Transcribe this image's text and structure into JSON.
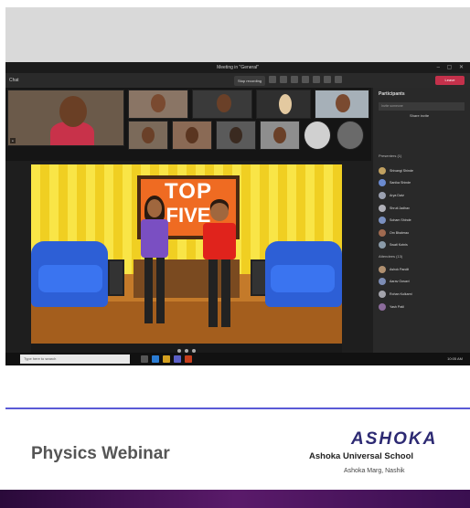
{
  "window": {
    "title": "Meeting in \"General\""
  },
  "toolbar": {
    "left_label": "Chat",
    "record_label": "Stop recording",
    "leave_label": "Leave"
  },
  "participants_panel": {
    "title": "Participants",
    "search_placeholder": "Invite someone",
    "share_label": "Share invite",
    "section_presenters": "Presenters (1)",
    "section_attendees": "Attendees (13)",
    "names": [
      "Shivangi Shinde",
      "Sanika Shinde",
      "Arya Dalvi",
      "Shruti Jadhav",
      "Soham Shinde",
      "Om Bhalerao",
      "Swati Kotnis",
      "Ashok Pandit",
      "Aarav Gosavi",
      "Rohan Kulkarni",
      "Yash Patil"
    ]
  },
  "stage": {
    "sign_line1": "TOP",
    "sign_line2": "FIVE"
  },
  "taskbar": {
    "search_placeholder": "Type here to search",
    "time": "10:05 AM"
  },
  "footer": {
    "title": "Physics Webinar",
    "brand": "ASHOKA",
    "school": "Ashoka Universal School",
    "address": "Ashoka Marg, Nashik"
  },
  "colors": {
    "accent": "#5a5ad6",
    "brand": "#2d2a73",
    "leave": "#c4314b"
  }
}
